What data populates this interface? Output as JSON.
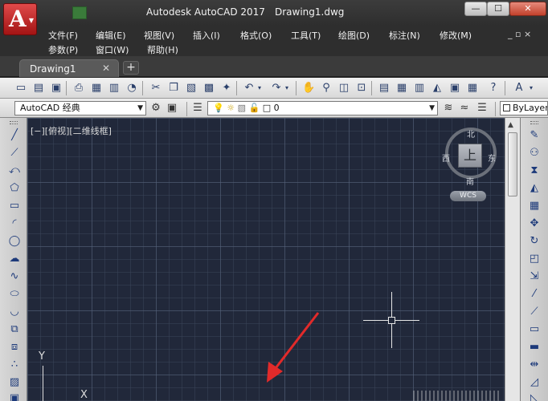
{
  "titlebar": {
    "app": "Autodesk AutoCAD 2017",
    "document": "Drawing1.dwg",
    "app_letter": "A",
    "minimize": "—",
    "maximize": "☐",
    "close": "✕"
  },
  "menu": {
    "row1": [
      "文件(F)",
      "编辑(E)",
      "视图(V)",
      "插入(I)",
      "格式(O)",
      "工具(T)",
      "绘图(D)",
      "标注(N)",
      "修改(M)"
    ],
    "row2": [
      "参数(P)",
      "窗口(W)",
      "帮助(H)"
    ],
    "mdi_controls": "_ ▫ ×"
  },
  "tabs": [
    {
      "label": "Drawing1",
      "close": "✕"
    }
  ],
  "new_tab": "+",
  "toolbar_styles": {
    "workspace": "AutoCAD 经典",
    "layer_value": "0",
    "bylayer": "ByLayer"
  },
  "viewport": {
    "label": "[−][俯视][二维线框]",
    "compass": {
      "north": "北",
      "south": "南",
      "east": "东",
      "west": "西"
    },
    "cube_face": "上",
    "wcs": "WCS"
  },
  "ucs": {
    "y": "Y",
    "x": "X"
  },
  "colors": {
    "annotation_arrow": "#e12a2a",
    "canvas": "#21283a"
  }
}
